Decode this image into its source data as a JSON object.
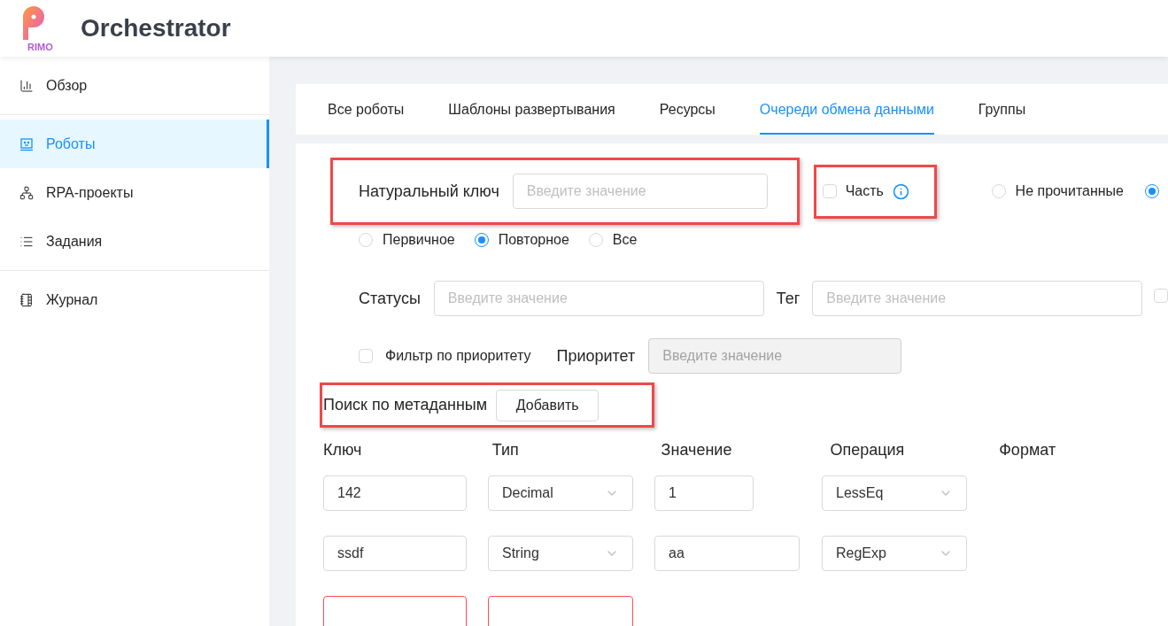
{
  "header": {
    "logo_text": "RIMO",
    "title": "Orchestrator"
  },
  "sidebar": {
    "sections": [
      {
        "items": [
          {
            "label": "Обзор",
            "selected": false
          }
        ]
      },
      {
        "items": [
          {
            "label": "Роботы",
            "selected": true
          },
          {
            "label": "RPA-проекты",
            "selected": false
          },
          {
            "label": "Задания",
            "selected": false
          }
        ]
      },
      {
        "items": [
          {
            "label": "Журнал",
            "selected": false
          }
        ]
      }
    ]
  },
  "tabs": [
    {
      "label": "Все роботы",
      "selected": false
    },
    {
      "label": "Шаблоны развертывания",
      "selected": false
    },
    {
      "label": "Ресурсы",
      "selected": false
    },
    {
      "label": "Очереди обмена данными",
      "selected": true
    },
    {
      "label": "Группы",
      "selected": false
    }
  ],
  "filters": {
    "natural_key": {
      "label": "Натуральный ключ",
      "placeholder": "Введите значение"
    },
    "part": {
      "label": "Часть",
      "checked": false
    },
    "read_state": [
      {
        "label": "Не прочитанные",
        "selected": false
      },
      {
        "selected": true
      }
    ],
    "attempt": [
      {
        "label": "Первичное",
        "selected": false
      },
      {
        "label": "Повторное",
        "selected": true
      },
      {
        "label": "Все",
        "selected": false
      }
    ],
    "statuses": {
      "label": "Статусы",
      "placeholder": "Введите значение"
    },
    "tag": {
      "label": "Тег",
      "placeholder": "Введите значение"
    },
    "tag_checkbox": {
      "checked": false
    },
    "priority_filter": {
      "label": "Фильтр по приоритету",
      "checked": false
    },
    "priority": {
      "label": "Приоритет",
      "placeholder": "Введите значение",
      "disabled": true
    }
  },
  "metadata": {
    "label": "Поиск по метаданным",
    "add_button": "Добавить",
    "columns": [
      "Ключ",
      "Тип",
      "Значение",
      "Операция",
      "Формат"
    ],
    "rows": [
      {
        "key": "142",
        "type": "Decimal",
        "value": "1",
        "operation": "LessEq",
        "invalid": false,
        "value_wide": false
      },
      {
        "key": "ssdf",
        "type": "String",
        "value": "aa",
        "operation": "RegExp",
        "invalid": false,
        "value_wide": true
      },
      {
        "invalid": true
      }
    ]
  }
}
